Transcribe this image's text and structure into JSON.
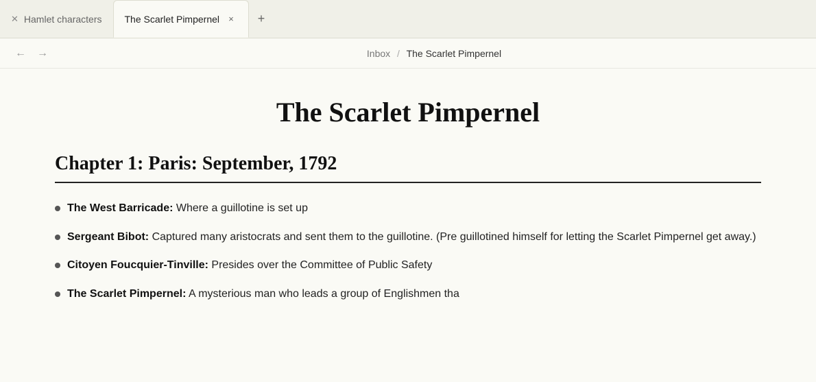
{
  "tabs": [
    {
      "id": "tab1",
      "label": "Hamlet characters",
      "icon": "✕",
      "active": false,
      "closeable": false
    },
    {
      "id": "tab2",
      "label": "The Scarlet Pimpernel",
      "active": true,
      "closeable": true
    }
  ],
  "nav": {
    "back_disabled": false,
    "forward_disabled": true,
    "breadcrumb_root": "Inbox",
    "breadcrumb_separator": "/",
    "breadcrumb_current": "The Scarlet Pimpernel"
  },
  "content": {
    "title": "The Scarlet Pimpernel",
    "chapter": "Chapter 1: Paris: September, 1792",
    "items": [
      {
        "bold": "The West Barricade:",
        "text": " Where a guillotine is set up"
      },
      {
        "bold": "Sergeant Bibot:",
        "text": " Captured many aristocrats and sent them to the guillotine. (Pre guillotined himself for letting the Scarlet Pimpernel get away.)"
      },
      {
        "bold": "Citoyen Foucquier-Tinville:",
        "text": " Presides over the Committee of Public Safety"
      },
      {
        "bold": "The Scarlet Pimpernel:",
        "text": " A mysterious man who leads a group of Englishmen tha"
      }
    ]
  }
}
